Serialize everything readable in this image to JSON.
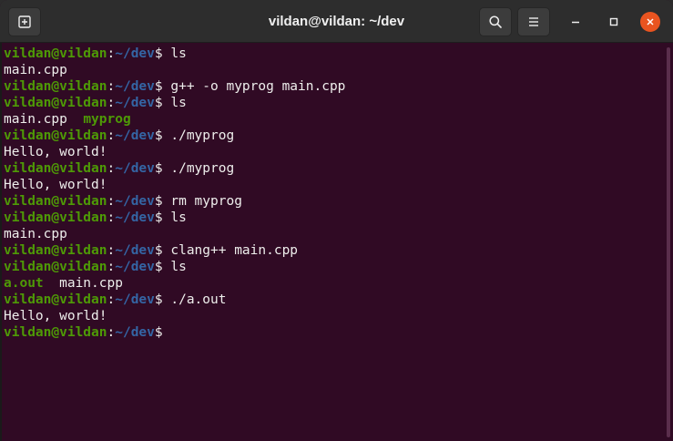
{
  "window": {
    "title": "vildan@vildan: ~/dev"
  },
  "titlebar": {
    "new_tab_icon": "new-tab-icon",
    "search_icon": "search-icon",
    "menu_icon": "hamburger-menu-icon",
    "minimize_icon": "minimize-icon",
    "maximize_icon": "maximize-icon",
    "close_icon": "close-icon"
  },
  "colors": {
    "background": "#300a24",
    "prompt_user": "#4e9a06",
    "prompt_path": "#3465a4",
    "executable": "#4e9a06",
    "close_button": "#e95420"
  },
  "prompt": {
    "user": "vildan@vildan",
    "colon": ":",
    "path": "~/dev",
    "dollar": "$"
  },
  "terminal": {
    "lines": [
      {
        "type": "cmd",
        "text": " ls"
      },
      {
        "type": "out",
        "text": "main.cpp"
      },
      {
        "type": "cmd",
        "text": " g++ -o myprog main.cpp"
      },
      {
        "type": "cmd",
        "text": " ls"
      },
      {
        "type": "out_mixed",
        "parts": [
          {
            "text": "main.cpp  ",
            "exec": false
          },
          {
            "text": "myprog",
            "exec": true
          }
        ]
      },
      {
        "type": "cmd",
        "text": " ./myprog"
      },
      {
        "type": "out",
        "text": "Hello, world!"
      },
      {
        "type": "cmd",
        "text": " ./myprog"
      },
      {
        "type": "out",
        "text": "Hello, world!"
      },
      {
        "type": "cmd",
        "text": " rm myprog"
      },
      {
        "type": "cmd",
        "text": " ls"
      },
      {
        "type": "out",
        "text": "main.cpp"
      },
      {
        "type": "cmd",
        "text": " clang++ main.cpp"
      },
      {
        "type": "cmd",
        "text": " ls"
      },
      {
        "type": "out_mixed",
        "parts": [
          {
            "text": "a.out",
            "exec": true
          },
          {
            "text": "  main.cpp",
            "exec": false
          }
        ]
      },
      {
        "type": "cmd",
        "text": " ./a.out"
      },
      {
        "type": "out",
        "text": "Hello, world!"
      },
      {
        "type": "cmd",
        "text": ""
      }
    ]
  }
}
